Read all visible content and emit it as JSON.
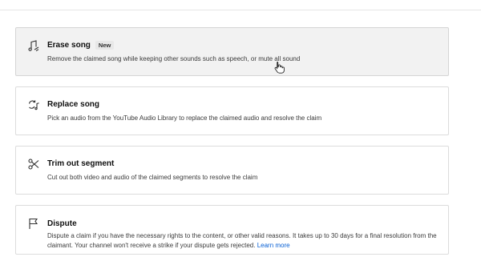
{
  "options": [
    {
      "key": "erase",
      "title": "Erase song",
      "badge": "New",
      "icon": "music-note-erase-icon",
      "description": "Remove the claimed song while keeping other sounds such as speech, or mute all sound"
    },
    {
      "key": "replace",
      "title": "Replace song",
      "icon": "replace-audio-icon",
      "description": "Pick an audio from the YouTube Audio Library to replace the claimed audio and resolve the claim"
    },
    {
      "key": "trim",
      "title": "Trim out segment",
      "icon": "scissors-icon",
      "description": "Cut out both video and audio of the claimed segments to resolve the claim"
    },
    {
      "key": "dispute",
      "title": "Dispute",
      "icon": "flag-icon",
      "description": "Dispute a claim if you have the necessary rights to the content, or other valid reasons. It takes up to 30 days for a final resolution from the claimant. Your channel won't receive a strike if your dispute gets rejected.",
      "link": "Learn more"
    }
  ],
  "colors": {
    "link": "#065fd4",
    "hover_bg": "#f2f2f2",
    "border": "#dcdcdc"
  }
}
